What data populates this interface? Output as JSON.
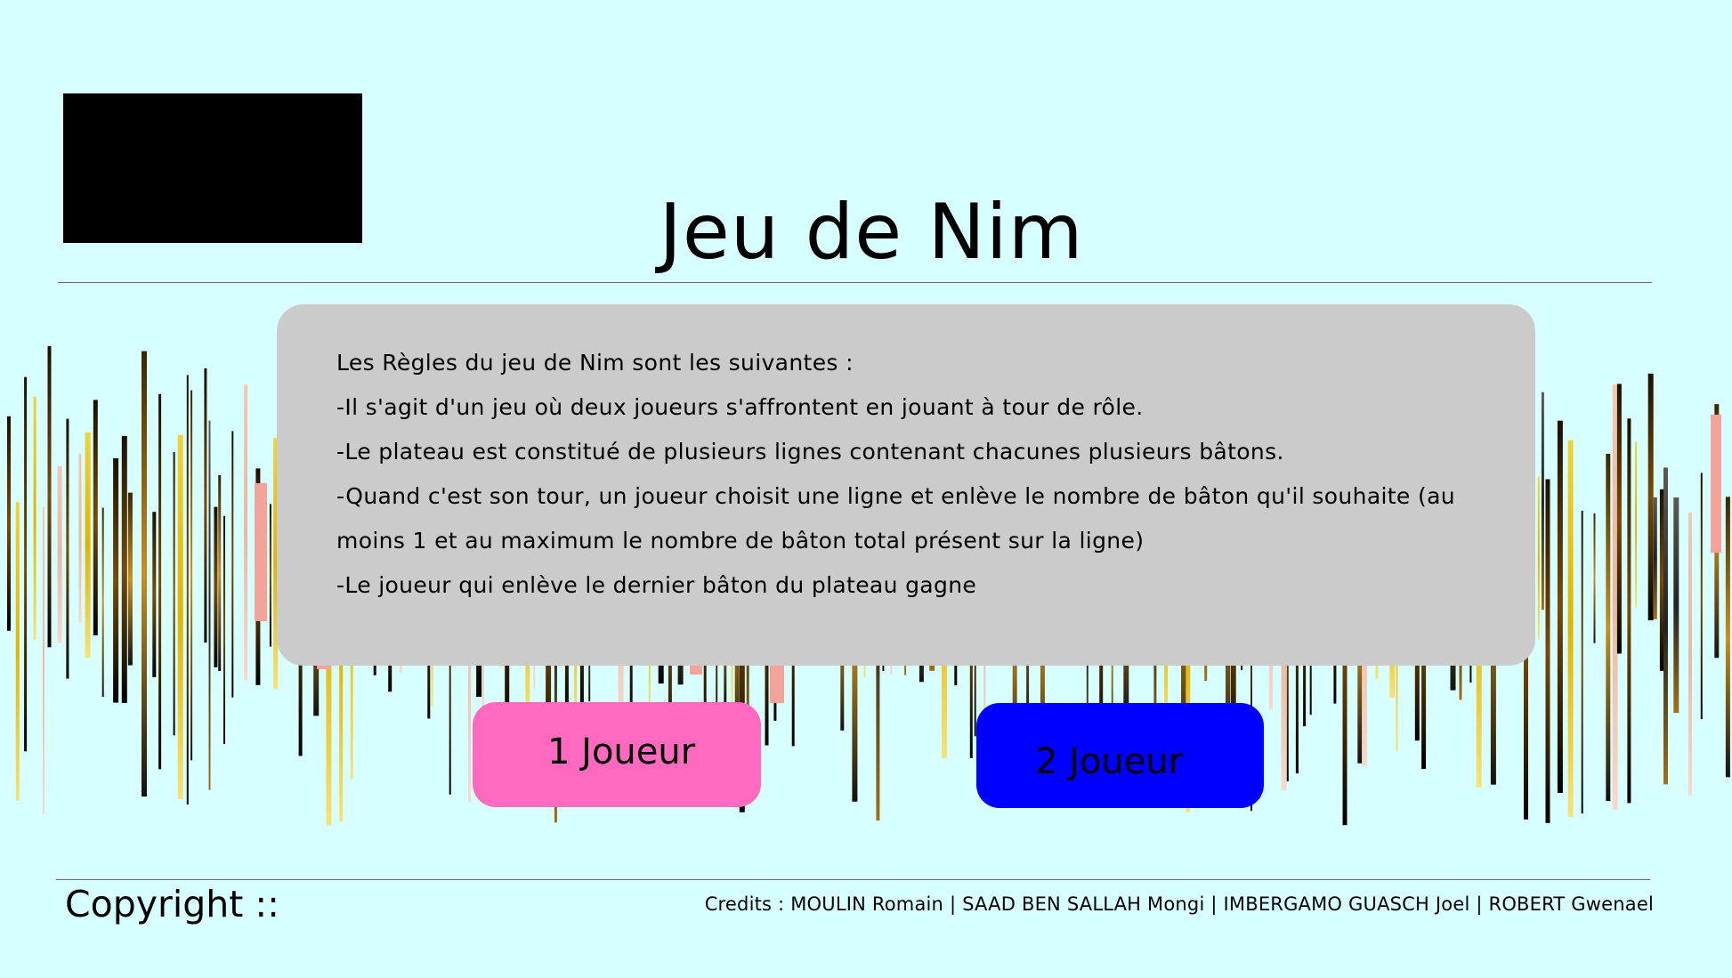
{
  "header": {
    "title": "Jeu de Nim"
  },
  "rules": {
    "lines": [
      "Les Règles du jeu de Nim sont les suivantes :",
      "-Il s'agit d'un jeu où deux joueurs s'affrontent en jouant à tour de rôle.",
      "-Le plateau est constitué de plusieurs lignes contenant chacunes plusieurs bâtons.",
      "-Quand c'est son tour, un joueur choisit une ligne et enlève le nombre de bâton qu'il souhaite (au",
      "moins 1 et au maximum le nombre de bâton total présent sur la ligne)",
      "-Le joueur qui enlève le dernier bâton du plateau gagne"
    ]
  },
  "buttons": {
    "one_player": "1 Joueur",
    "two_player": "2 Joueur"
  },
  "footer": {
    "copyright": "Copyright ::",
    "credits": "Credits : MOULIN Romain | SAAD BEN SALLAH Mongi | IMBERGAMO GUASCH Joel | ROBERT Gwenael"
  },
  "colors": {
    "background": "#d8ffff",
    "panel": "#cbcbcb",
    "one_player_button": "#ff69c0",
    "two_player_button": "#0000ff",
    "logo_placeholder": "#000000"
  },
  "icons": {
    "logo": "logo-placeholder-black-box"
  }
}
